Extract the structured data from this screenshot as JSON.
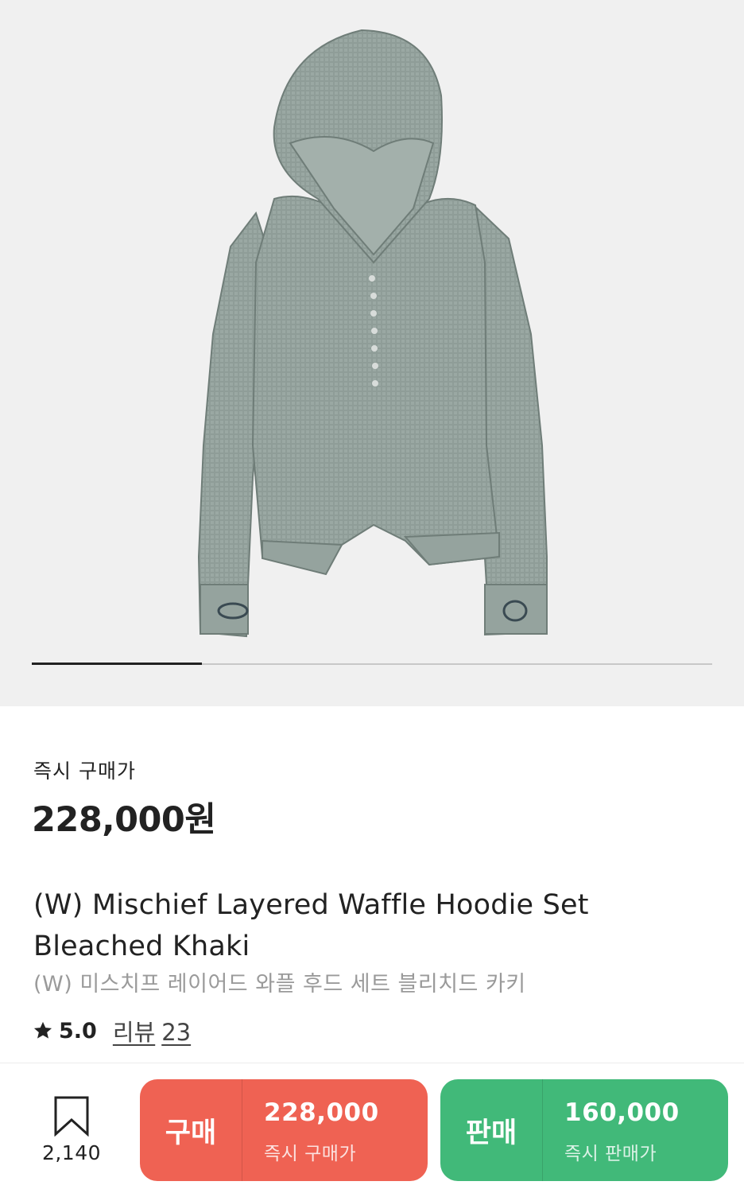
{
  "gallery": {
    "image_alt": "waffle hoodie product photo",
    "slide_progress": 0.25
  },
  "price": {
    "label": "즉시 구매가",
    "value": "228,000원"
  },
  "product": {
    "title_en": "(W) Mischief Layered Waffle Hoodie Set Bleached Khaki",
    "title_ko": "(W) 미스치프 레이어드 와플 후드 세트 블리치드 카키"
  },
  "rating": {
    "icon": "star-icon",
    "score": "5.0",
    "review_label": "리뷰",
    "review_count": "23"
  },
  "bottom_bar": {
    "wish_icon": "bookmark-icon",
    "wish_count": "2,140",
    "buy": {
      "label": "구매",
      "price": "228,000",
      "sub": "즉시 구매가",
      "color": "#ef6253"
    },
    "sell": {
      "label": "판매",
      "price": "160,000",
      "sub": "즉시 판매가",
      "color": "#41b979"
    }
  }
}
